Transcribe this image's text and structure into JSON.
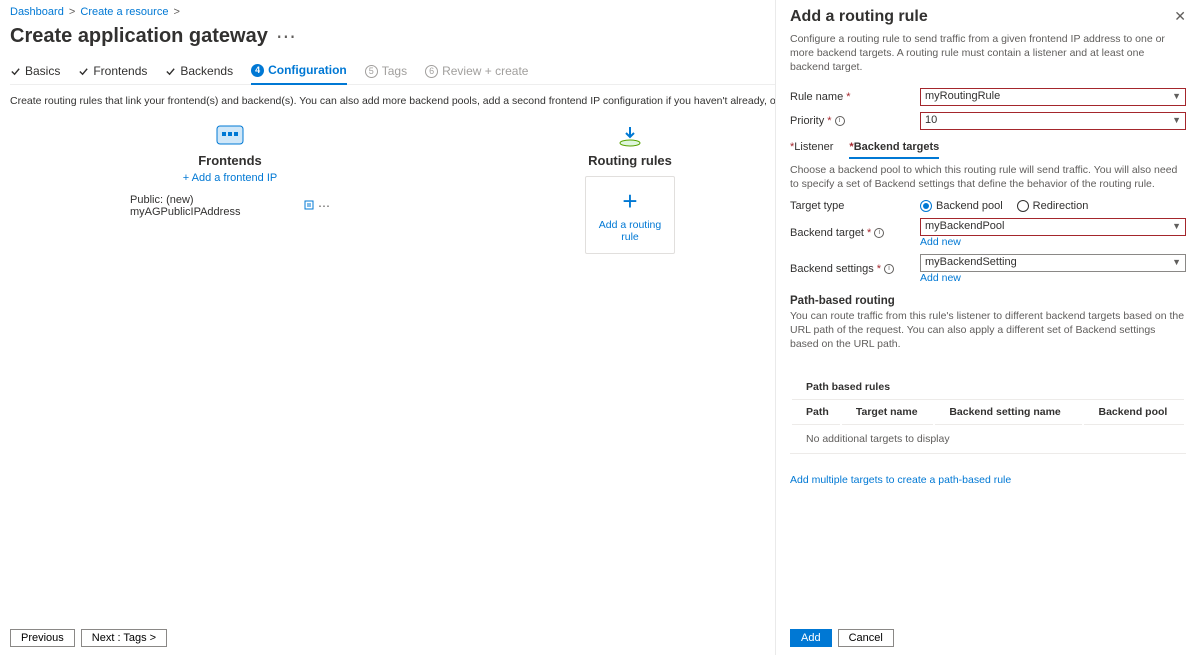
{
  "breadcrumb": [
    "Dashboard",
    "Create a resource"
  ],
  "page_title": "Create application gateway",
  "tabs": {
    "basics": "Basics",
    "frontends": "Frontends",
    "backends": "Backends",
    "configuration": "Configuration",
    "tags": "Tags",
    "review": "Review + create"
  },
  "helper_text": "Create routing rules that link your frontend(s) and backend(s). You can also add more backend pools, add a second frontend IP configuration if you haven't already, or edit previous configurations.",
  "frontends": {
    "title": "Frontends",
    "add_link": "+ Add a frontend IP",
    "item_prefix": "Public: (new) ",
    "item_name": "myAGPublicIPAddress"
  },
  "routing": {
    "title": "Routing rules",
    "card_label": "Add a routing rule"
  },
  "footer": {
    "previous": "Previous",
    "next": "Next : Tags >"
  },
  "panel": {
    "title": "Add a routing rule",
    "description": "Configure a routing rule to send traffic from a given frontend IP address to one or more backend targets. A routing rule must contain a listener and at least one backend target.",
    "rule_name_label": "Rule name",
    "rule_name_value": "myRoutingRule",
    "priority_label": "Priority",
    "priority_value": "10",
    "subtabs": {
      "listener": "Listener",
      "backend": "Backend targets"
    },
    "backend_desc": "Choose a backend pool to which this routing rule will send traffic. You will also need to specify a set of Backend settings that define the behavior of the routing rule.",
    "target_type_label": "Target type",
    "target_type_options": {
      "pool": "Backend pool",
      "redirect": "Redirection"
    },
    "backend_target_label": "Backend target",
    "backend_target_value": "myBackendPool",
    "backend_settings_label": "Backend settings",
    "backend_settings_value": "myBackendSetting",
    "add_new": "Add new",
    "path_title": "Path-based routing",
    "path_desc": "You can route traffic from this rule's listener to different backend targets based on the URL path of the request. You can also apply a different set of Backend settings based on the URL path.",
    "path_table_title": "Path based rules",
    "path_cols": [
      "Path",
      "Target name",
      "Backend setting name",
      "Backend pool"
    ],
    "path_empty": "No additional targets to display",
    "path_add_link": "Add multiple targets to create a path-based rule",
    "footer": {
      "add": "Add",
      "cancel": "Cancel"
    }
  }
}
